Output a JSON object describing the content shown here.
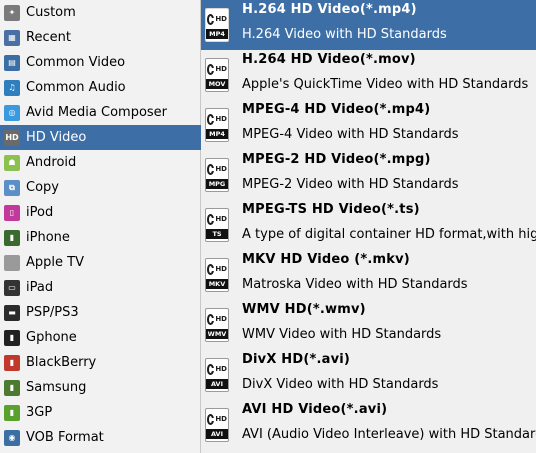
{
  "categories": [
    {
      "label": "Custom",
      "icon": "star-wrench-icon",
      "color": "#7a7a7a",
      "glyph": "✦"
    },
    {
      "label": "Recent",
      "icon": "recent-grid-icon",
      "color": "#4a6fa5",
      "glyph": "▦"
    },
    {
      "label": "Common Video",
      "icon": "film-strip-icon",
      "color": "#3a6ea5",
      "glyph": "▤"
    },
    {
      "label": "Common Audio",
      "icon": "headphones-icon",
      "color": "#2f7fbf",
      "glyph": "♫"
    },
    {
      "label": "Avid Media Composer",
      "icon": "avid-logo-icon",
      "color": "#3b9adf",
      "glyph": "◎"
    },
    {
      "label": "HD Video",
      "icon": "hd-badge-icon",
      "color": "#6a6a6a",
      "glyph": "HD"
    },
    {
      "label": "Android",
      "icon": "android-robot-icon",
      "color": "#8cc152",
      "glyph": "☗"
    },
    {
      "label": "Copy",
      "icon": "copy-disc-icon",
      "color": "#5a8fc8",
      "glyph": "⧉"
    },
    {
      "label": "iPod",
      "icon": "ipod-icon",
      "color": "#c0399b",
      "glyph": "▯"
    },
    {
      "label": "iPhone",
      "icon": "iphone-icon",
      "color": "#3b6a2e",
      "glyph": "▮"
    },
    {
      "label": "Apple TV",
      "icon": "apple-logo-icon",
      "color": "#9a9a9a",
      "glyph": ""
    },
    {
      "label": "iPad",
      "icon": "ipad-icon",
      "color": "#333333",
      "glyph": "▭"
    },
    {
      "label": "PSP/PS3",
      "icon": "psp-console-icon",
      "color": "#2b2b2b",
      "glyph": "▬"
    },
    {
      "label": "Gphone",
      "icon": "gphone-icon",
      "color": "#222222",
      "glyph": "▮"
    },
    {
      "label": "BlackBerry",
      "icon": "blackberry-icon",
      "color": "#c0392b",
      "glyph": "▮"
    },
    {
      "label": "Samsung",
      "icon": "samsung-phone-icon",
      "color": "#4c7a2e",
      "glyph": "▮"
    },
    {
      "label": "3GP",
      "icon": "3gp-phone-icon",
      "color": "#5aa02c",
      "glyph": "▮"
    },
    {
      "label": "VOB Format",
      "icon": "vob-disc-icon",
      "color": "#3a6ea5",
      "glyph": "◉"
    }
  ],
  "selected_category": "HD Video",
  "formats": [
    {
      "title": "H.264 HD Video(*.mp4)",
      "desc": "H.264 Video with HD Standards",
      "ext": "MP4"
    },
    {
      "title": "H.264 HD Video(*.mov)",
      "desc": "Apple's QuickTime Video with HD Standards",
      "ext": "MOV"
    },
    {
      "title": "MPEG-4 HD Video(*.mp4)",
      "desc": "MPEG-4 Video with HD Standards",
      "ext": "MP4"
    },
    {
      "title": "MPEG-2 HD Video(*.mpg)",
      "desc": "MPEG-2 Video with HD Standards",
      "ext": "MPG"
    },
    {
      "title": "MPEG-TS HD Video(*.ts)",
      "desc": "A type of digital container HD format,with high",
      "ext": "TS"
    },
    {
      "title": "MKV HD Video (*.mkv)",
      "desc": "Matroska Video with HD Standards",
      "ext": "MKV"
    },
    {
      "title": "WMV HD(*.wmv)",
      "desc": "WMV Video with HD Standards",
      "ext": "WMV"
    },
    {
      "title": "DivX HD(*.avi)",
      "desc": "DivX Video with HD Standards",
      "ext": "AVI"
    },
    {
      "title": "AVI HD Video(*.avi)",
      "desc": "AVI (Audio Video Interleave) with HD Standard",
      "ext": "AVI"
    }
  ],
  "selected_format": "H.264 HD Video(*.mp4)",
  "colors": {
    "selection": "#3d6fa6",
    "sidebar_bg": "#f2f2f2",
    "list_bg": "#f0f0f0"
  }
}
